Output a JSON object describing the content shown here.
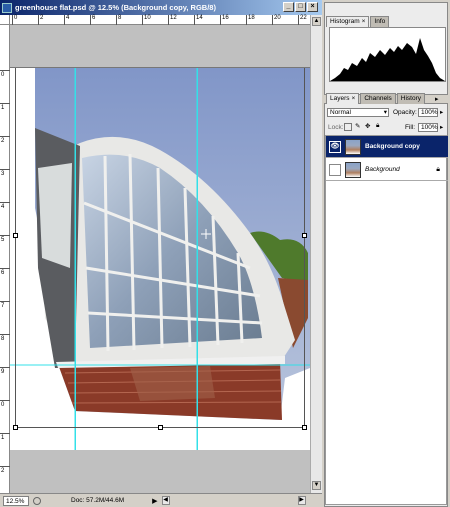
{
  "window": {
    "title": "greenhouse flat.psd @ 12.5% (Background copy, RGB/8)",
    "min_label": "_",
    "max_label": "□",
    "close_label": "×"
  },
  "rulers": {
    "top_marks": [
      "0",
      "2",
      "4",
      "6",
      "8",
      "10",
      "12",
      "14",
      "16",
      "18",
      "20",
      "22"
    ],
    "left_marks": [
      "0",
      "1",
      "2",
      "3",
      "4",
      "5",
      "6",
      "7",
      "8",
      "9",
      "0",
      "1",
      "2"
    ]
  },
  "status": {
    "zoom": "12.5%",
    "doc": "Doc: 57.2M/44.6M"
  },
  "panels": {
    "top_tabs": [
      {
        "label": "Histogram",
        "close": "×"
      },
      {
        "label": "Info"
      }
    ],
    "layer_tabs": [
      {
        "label": "Layers",
        "close": "×"
      },
      {
        "label": "Channels"
      },
      {
        "label": "History"
      }
    ],
    "blend_mode": "Normal",
    "opacity_label": "Opacity:",
    "opacity_value": "100%",
    "lock_label": "Lock:",
    "fill_label": "Fill:",
    "fill_value": "100%",
    "layers": [
      {
        "name": "Background copy",
        "selected": true
      },
      {
        "name": "Background",
        "selected": false
      }
    ]
  },
  "colors": {
    "guide": "#33e0e8",
    "selected_layer": "#0a246a",
    "titlebar": "#0a246a"
  }
}
